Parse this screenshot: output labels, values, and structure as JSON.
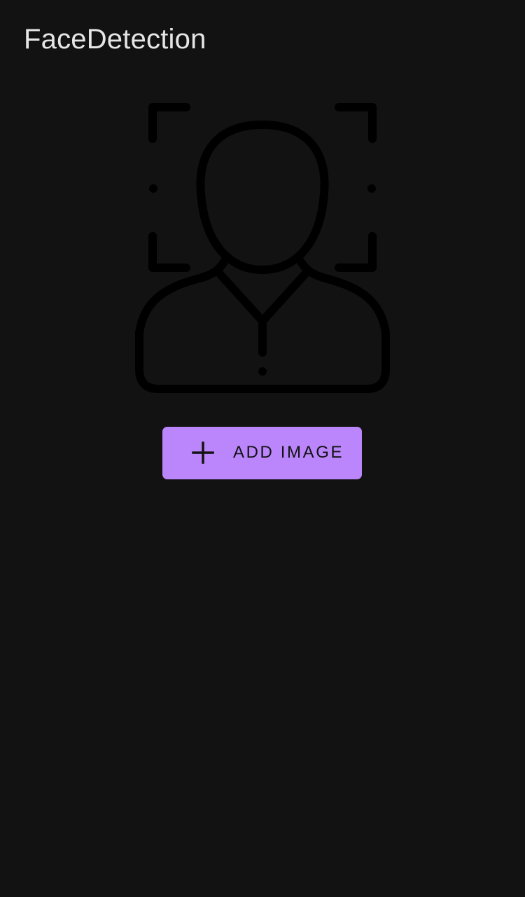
{
  "app": {
    "title": "FaceDetection"
  },
  "illustration": {
    "icon": "face-detection-icon"
  },
  "add_image_button": {
    "label": "ADD IMAGE",
    "icon": "plus-icon",
    "background": "#bb86fc"
  },
  "colors": {
    "background": "#121212",
    "title": "#e6e6e6",
    "illustration_stroke": "#000000"
  }
}
